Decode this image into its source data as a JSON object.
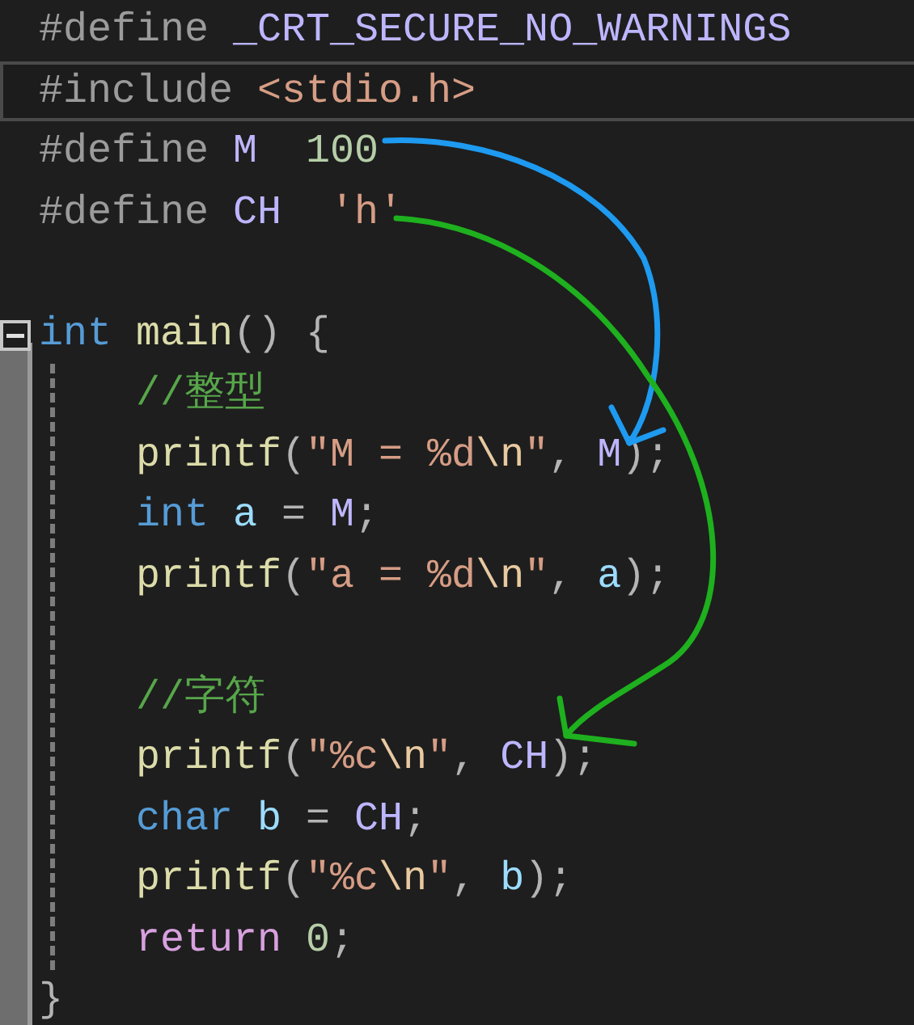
{
  "editor": {
    "lines": [
      {
        "kind": "code",
        "current": false,
        "tokens": [
          {
            "text": "#define ",
            "kind": "preprocessor"
          },
          {
            "text": "_CRT_SECURE_NO_WARNINGS",
            "kind": "macro"
          }
        ]
      },
      {
        "kind": "code",
        "current": true,
        "tokens": [
          {
            "text": "#include ",
            "kind": "preprocessor"
          },
          {
            "text": "<stdio.h>",
            "kind": "string"
          }
        ]
      },
      {
        "kind": "code",
        "current": false,
        "tokens": [
          {
            "text": "#define ",
            "kind": "preprocessor"
          },
          {
            "text": "M  ",
            "kind": "macro"
          },
          {
            "text": "100",
            "kind": "number"
          }
        ]
      },
      {
        "kind": "code",
        "current": false,
        "tokens": [
          {
            "text": "#define ",
            "kind": "preprocessor"
          },
          {
            "text": "CH  ",
            "kind": "macro"
          },
          {
            "text": "'h'",
            "kind": "string"
          }
        ]
      },
      {
        "kind": "blank",
        "current": false
      },
      {
        "kind": "block",
        "current": false,
        "collapsed": false,
        "tokens": [
          {
            "text": "int ",
            "kind": "keyword"
          },
          {
            "text": "main",
            "kind": "function"
          },
          {
            "text": "() {",
            "kind": "punct"
          }
        ],
        "children": [
          {
            "kind": "code",
            "current": false,
            "tokens": [
              {
                "text": "//整型",
                "kind": "comment"
              }
            ]
          },
          {
            "kind": "code",
            "current": false,
            "tokens": [
              {
                "text": "printf",
                "kind": "function"
              },
              {
                "text": "(",
                "kind": "punct"
              },
              {
                "text": "\"M = %d",
                "kind": "string"
              },
              {
                "text": "\\n",
                "kind": "escape"
              },
              {
                "text": "\"",
                "kind": "string"
              },
              {
                "text": ", ",
                "kind": "punct"
              },
              {
                "text": "M",
                "kind": "macro"
              },
              {
                "text": ");",
                "kind": "punct"
              }
            ]
          },
          {
            "kind": "code",
            "current": false,
            "tokens": [
              {
                "text": "int ",
                "kind": "keyword"
              },
              {
                "text": "a",
                "kind": "variable"
              },
              {
                "text": " = ",
                "kind": "punct"
              },
              {
                "text": "M",
                "kind": "macro"
              },
              {
                "text": ";",
                "kind": "punct"
              }
            ]
          },
          {
            "kind": "code",
            "current": false,
            "tokens": [
              {
                "text": "printf",
                "kind": "function"
              },
              {
                "text": "(",
                "kind": "punct"
              },
              {
                "text": "\"a = %d",
                "kind": "string"
              },
              {
                "text": "\\n",
                "kind": "escape"
              },
              {
                "text": "\"",
                "kind": "string"
              },
              {
                "text": ", ",
                "kind": "punct"
              },
              {
                "text": "a",
                "kind": "variable"
              },
              {
                "text": ");",
                "kind": "punct"
              }
            ]
          },
          {
            "kind": "blank",
            "current": false
          },
          {
            "kind": "code",
            "current": false,
            "tokens": [
              {
                "text": "//字符",
                "kind": "comment"
              }
            ]
          },
          {
            "kind": "code",
            "current": false,
            "tokens": [
              {
                "text": "printf",
                "kind": "function"
              },
              {
                "text": "(",
                "kind": "punct"
              },
              {
                "text": "\"%c",
                "kind": "string"
              },
              {
                "text": "\\n",
                "kind": "escape"
              },
              {
                "text": "\"",
                "kind": "string"
              },
              {
                "text": ", ",
                "kind": "punct"
              },
              {
                "text": "CH",
                "kind": "macro"
              },
              {
                "text": ");",
                "kind": "punct"
              }
            ]
          },
          {
            "kind": "code",
            "current": false,
            "tokens": [
              {
                "text": "char ",
                "kind": "keyword"
              },
              {
                "text": "b",
                "kind": "variable"
              },
              {
                "text": " = ",
                "kind": "punct"
              },
              {
                "text": "CH",
                "kind": "macro"
              },
              {
                "text": ";",
                "kind": "punct"
              }
            ]
          },
          {
            "kind": "code",
            "current": false,
            "tokens": [
              {
                "text": "printf",
                "kind": "function"
              },
              {
                "text": "(",
                "kind": "punct"
              },
              {
                "text": "\"%c",
                "kind": "string"
              },
              {
                "text": "\\n",
                "kind": "escape"
              },
              {
                "text": "\"",
                "kind": "string"
              },
              {
                "text": ", ",
                "kind": "punct"
              },
              {
                "text": "b",
                "kind": "variable"
              },
              {
                "text": ");",
                "kind": "punct"
              }
            ]
          },
          {
            "kind": "code",
            "current": false,
            "tokens": [
              {
                "text": "return ",
                "kind": "control"
              },
              {
                "text": "0",
                "kind": "number"
              },
              {
                "text": ";",
                "kind": "punct"
              }
            ]
          }
        ],
        "end_tokens": [
          {
            "text": "}",
            "kind": "punct"
          }
        ]
      }
    ]
  },
  "annotations": [
    {
      "kind": "arrow",
      "color": "#1e9af0"
    },
    {
      "kind": "arrow",
      "color": "#1eb01e"
    }
  ]
}
